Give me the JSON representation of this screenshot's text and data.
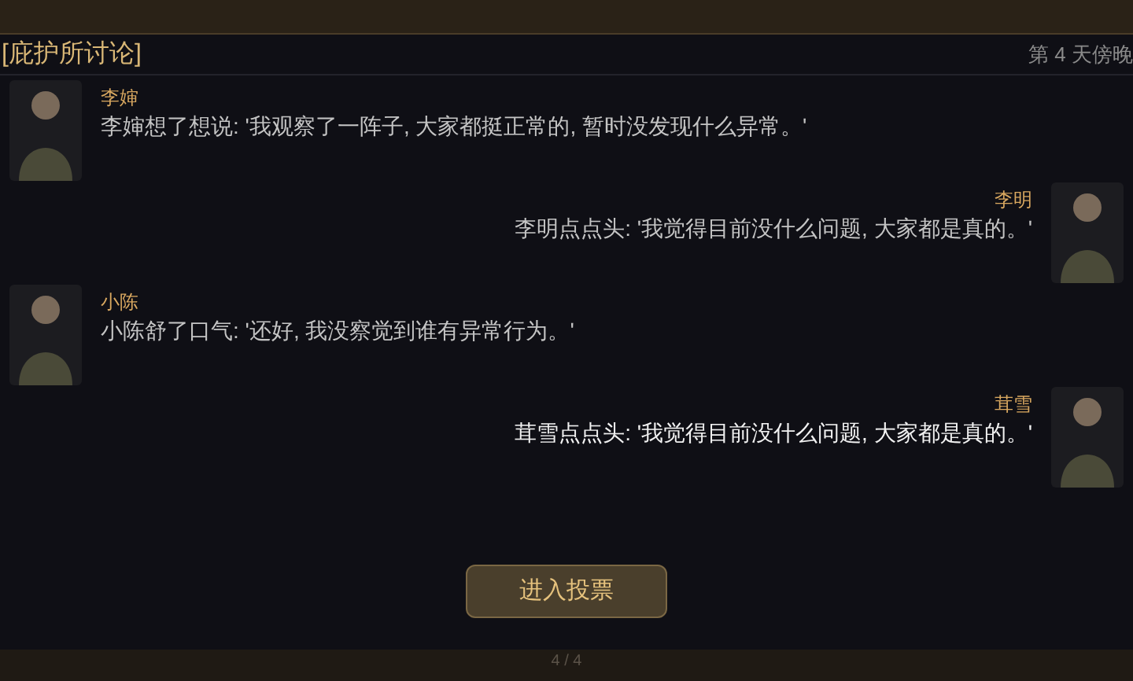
{
  "header": {
    "title": "[庇护所讨论]",
    "time": "第 4 天傍晚"
  },
  "messages": [
    {
      "kind": "left",
      "speaker": "李婶",
      "text": "李婶想了想说: '我观察了一阵子, 大家都挺正常的, 暂时没发现什么异常。'",
      "highlighted": false
    },
    {
      "kind": "right",
      "speaker": "李明",
      "text": "李明点点头: '我觉得目前没什么问题, 大家都是真的。'",
      "highlighted": false
    },
    {
      "kind": "left",
      "speaker": "小陈",
      "text": "小陈舒了口气: '还好, 我没察觉到谁有异常行为。'",
      "highlighted": false
    },
    {
      "kind": "right",
      "speaker": "茸雪",
      "text": "茸雪点点头: '我觉得目前没什么问题, 大家都是真的。'",
      "highlighted": true
    }
  ],
  "vote_button": "进入投票",
  "page_indicator": "4 / 4"
}
